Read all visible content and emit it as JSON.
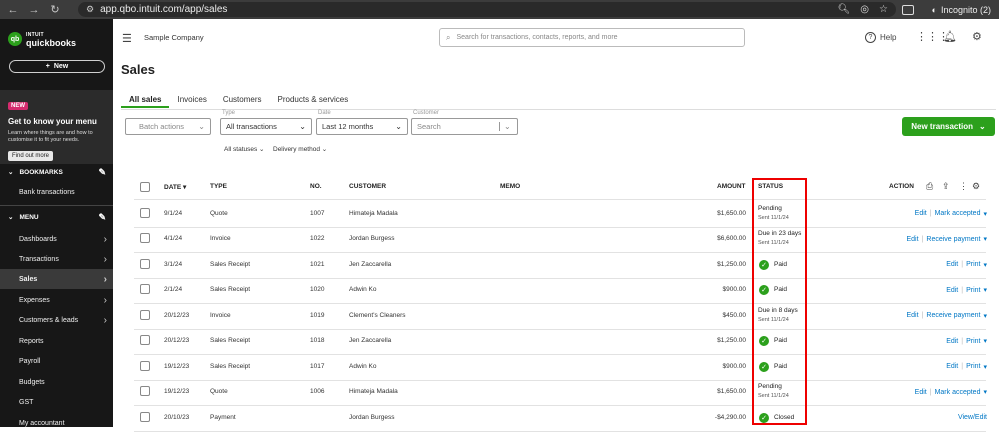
{
  "browser": {
    "url": "app.qbo.intuit.com/app/sales",
    "incognito_label": "Incognito (2)"
  },
  "sidebar": {
    "logo_top": "INTUIT",
    "logo_name": "quickbooks",
    "new_label": "New",
    "promo": {
      "badge": "NEW",
      "title": "Get to know your menu",
      "desc": "Learn where things are and how to customise it to fit your needs.",
      "button": "Find out more"
    },
    "bookmarks_label": "BOOKMARKS",
    "bookmark_item": "Bank transactions",
    "menu_label": "MENU",
    "items": [
      {
        "label": "Dashboards",
        "chev": true
      },
      {
        "label": "Transactions",
        "chev": true
      },
      {
        "label": "Sales",
        "chev": true
      },
      {
        "label": "Expenses",
        "chev": true
      },
      {
        "label": "Customers & leads",
        "chev": true
      },
      {
        "label": "Reports",
        "chev": false
      },
      {
        "label": "Payroll",
        "chev": false
      },
      {
        "label": "Budgets",
        "chev": false
      },
      {
        "label": "GST",
        "chev": false
      },
      {
        "label": "My accountant",
        "chev": false
      }
    ]
  },
  "topbar": {
    "company": "Sample Company",
    "search_placeholder": "Search for transactions, contacts, reports, and more",
    "help": "Help"
  },
  "page": {
    "title": "Sales",
    "tabs": [
      "All sales",
      "Invoices",
      "Customers",
      "Products & services"
    ]
  },
  "filters": {
    "batch": "Batch actions",
    "type_label": "Type",
    "type_value": "All transactions",
    "date_label": "Date",
    "date_value": "Last 12 months",
    "customer_label": "Customer",
    "customer_placeholder": "Search",
    "new_transaction": "New transaction",
    "all_statuses": "All statuses",
    "delivery_method": "Delivery method"
  },
  "table": {
    "headers": {
      "date": "DATE",
      "type": "TYPE",
      "no": "NO.",
      "customer": "CUSTOMER",
      "memo": "MEMO",
      "amount": "AMOUNT",
      "status": "STATUS",
      "action": "ACTION"
    },
    "rows": [
      {
        "date": "9/1/24",
        "type": "Quote",
        "no": "1007",
        "customer": "Himateja Madala",
        "amount": "$1,650.00",
        "status": "Pending",
        "sub": "Sent 11/1/24",
        "paid": false,
        "a1": "Edit",
        "a2": "Mark accepted"
      },
      {
        "date": "4/1/24",
        "type": "Invoice",
        "no": "1022",
        "customer": "Jordan Burgess",
        "amount": "$6,600.00",
        "status": "Due in 23 days",
        "sub": "Sent 11/1/24",
        "paid": false,
        "a1": "Edit",
        "a2": "Receive payment"
      },
      {
        "date": "3/1/24",
        "type": "Sales Receipt",
        "no": "1021",
        "customer": "Jen Zaccarella",
        "amount": "$1,250.00",
        "status": "Paid",
        "sub": "",
        "paid": true,
        "a1": "Edit",
        "a2": "Print"
      },
      {
        "date": "2/1/24",
        "type": "Sales Receipt",
        "no": "1020",
        "customer": "Adwin Ko",
        "amount": "$900.00",
        "status": "Paid",
        "sub": "",
        "paid": true,
        "a1": "Edit",
        "a2": "Print"
      },
      {
        "date": "20/12/23",
        "type": "Invoice",
        "no": "1019",
        "customer": "Clement's Cleaners",
        "amount": "$450.00",
        "status": "Due in 8 days",
        "sub": "Sent 11/1/24",
        "paid": false,
        "a1": "Edit",
        "a2": "Receive payment"
      },
      {
        "date": "20/12/23",
        "type": "Sales Receipt",
        "no": "1018",
        "customer": "Jen Zaccarella",
        "amount": "$1,250.00",
        "status": "Paid",
        "sub": "",
        "paid": true,
        "a1": "Edit",
        "a2": "Print"
      },
      {
        "date": "19/12/23",
        "type": "Sales Receipt",
        "no": "1017",
        "customer": "Adwin Ko",
        "amount": "$900.00",
        "status": "Paid",
        "sub": "",
        "paid": true,
        "a1": "Edit",
        "a2": "Print"
      },
      {
        "date": "19/12/23",
        "type": "Quote",
        "no": "1006",
        "customer": "Himateja Madala",
        "amount": "$1,650.00",
        "status": "Pending",
        "sub": "Sent 11/1/24",
        "paid": false,
        "a1": "Edit",
        "a2": "Mark accepted"
      },
      {
        "date": "20/10/23",
        "type": "Payment",
        "no": "",
        "customer": "Jordan Burgess",
        "amount": "-$4,290.00",
        "status": "Closed",
        "sub": "",
        "paid": true,
        "a1": "View/Edit",
        "a2": ""
      }
    ]
  }
}
